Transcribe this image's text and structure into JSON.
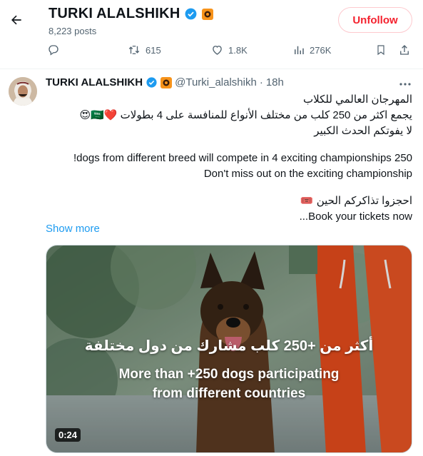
{
  "topbar": {
    "name": "TURKI ALALSHIKH",
    "posts": "8,223 posts",
    "unfollow_label": "Unfollow"
  },
  "actions": {
    "retweets": "615",
    "likes": "1.8K",
    "views": "276K"
  },
  "tweet": {
    "author": "TURKI ALALSHIKH",
    "handle": "@Turki_alalshikh",
    "separator": "·",
    "time": "18h",
    "lines": [
      "المهرجان العالمي للكلاب",
      "يجمع اكثر من 250 كلب من مختلف الأنواع  للمنافسة على 4 بطولات ❤️🇸🇦😍",
      "لا يفوتكم الحدث الكبير",
      "!dogs from different breed will compete in 4 exciting championships 250",
      "Don't miss out on the exciting championship",
      "احجزوا تذاكركم الحين 🎟️",
      "...Book your tickets now"
    ],
    "show_more": "Show more"
  },
  "media": {
    "caption_ar": "أكثر من +250 كلب مشارك من دول مختلفة",
    "caption_en_1": "More than +250 dogs participating",
    "caption_en_2": "from different countries",
    "duration": "0:24"
  },
  "colors": {
    "accent": "#1d9bf0",
    "unfollow": "#f4212e",
    "muted": "#536471",
    "verified": "#1d9bf0",
    "affiliate_badge": "#f7931a"
  },
  "icons": [
    "back-arrow-icon",
    "verified-icon",
    "affiliate-badge-icon",
    "reply-icon",
    "retweet-icon",
    "like-icon",
    "views-icon",
    "bookmark-icon",
    "share-icon",
    "more-icon"
  ]
}
